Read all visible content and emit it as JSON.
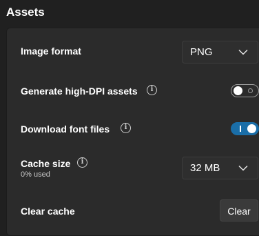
{
  "section": {
    "title": "Assets"
  },
  "settings": {
    "image_format": {
      "label": "Image format",
      "selected": "PNG"
    },
    "high_dpi": {
      "label": "Generate high-DPI assets",
      "enabled": false
    },
    "download_fonts": {
      "label": "Download font files",
      "enabled": true
    },
    "cache_size": {
      "label": "Cache size",
      "usage": "0% used",
      "selected": "32 MB"
    },
    "clear_cache": {
      "label": "Clear cache",
      "button_label": "Clear"
    }
  },
  "icons": {
    "info": "info-icon",
    "chevron": "chevron-down-icon"
  },
  "colors": {
    "background": "#202020",
    "panel": "#2b2b2b",
    "toggle_on": "#1a6ea8"
  }
}
